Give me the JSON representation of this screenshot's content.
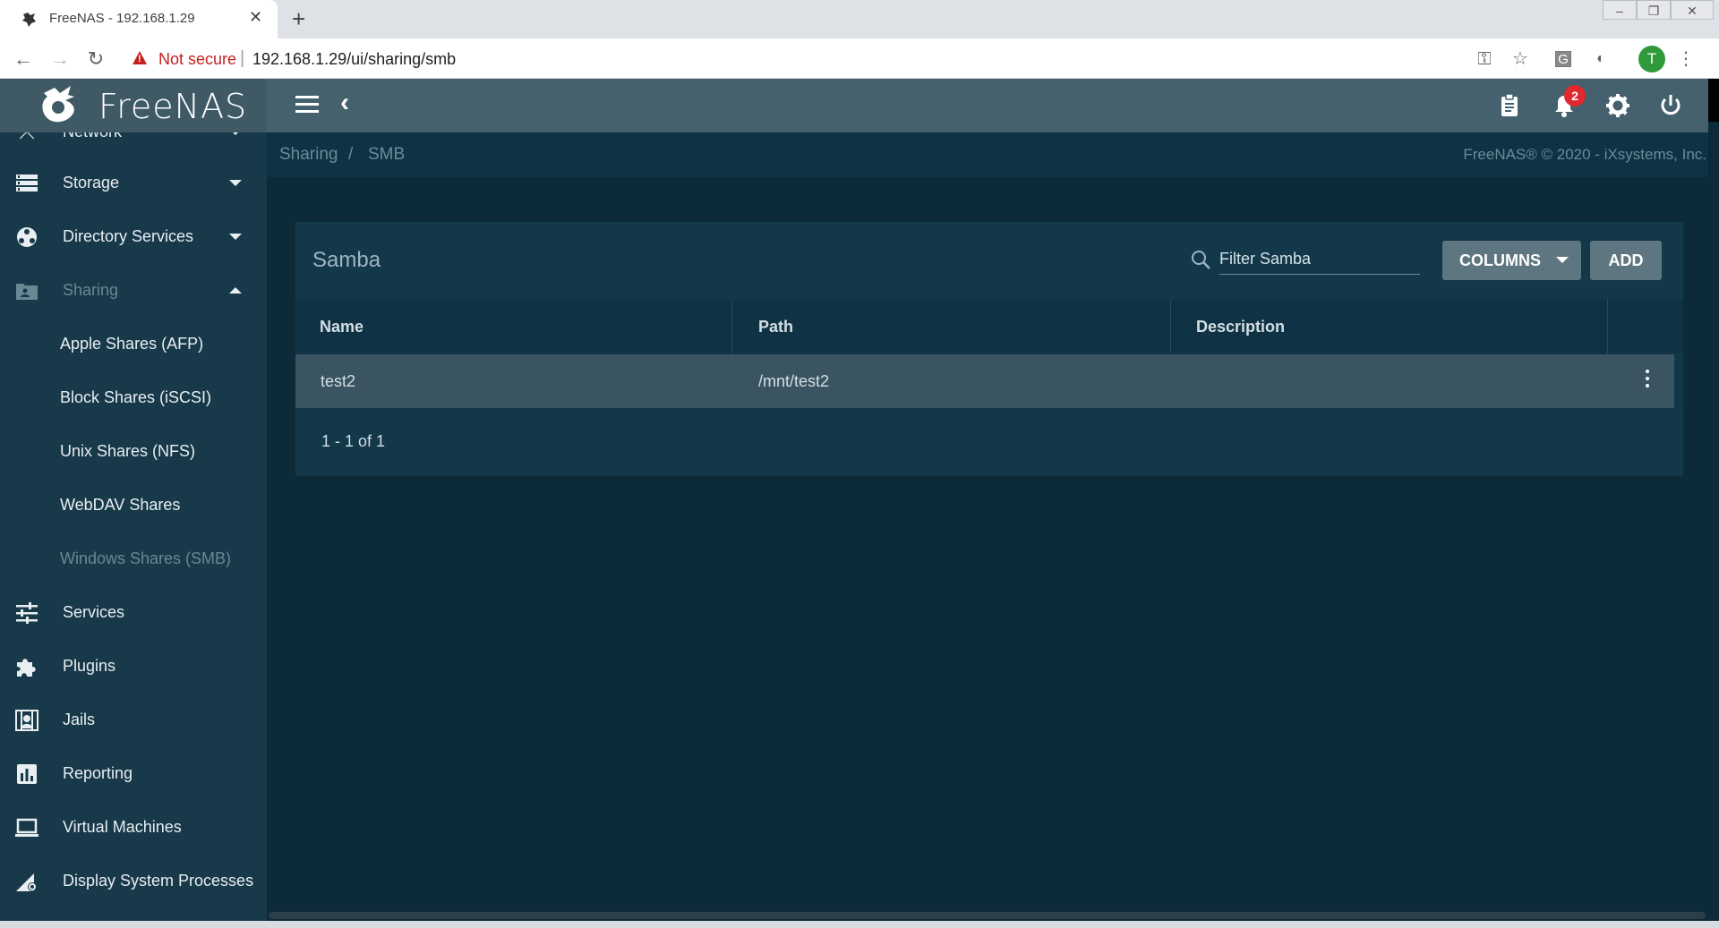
{
  "browser": {
    "tab_title": "FreeNAS - 192.168.1.29",
    "tab_close": "✕",
    "new_tab": "+",
    "security_label": "Not secure",
    "url": "192.168.1.29/ui/sharing/smb",
    "avatar_letter": "T"
  },
  "header": {
    "logo_text": "FreeNAS",
    "notification_count": "2"
  },
  "sidebar": {
    "items": [
      {
        "label": "Network",
        "icon": "network-icon"
      },
      {
        "label": "Storage",
        "icon": "storage-icon"
      },
      {
        "label": "Directory Services",
        "icon": "directory-services-icon"
      },
      {
        "label": "Sharing",
        "icon": "sharing-icon"
      },
      {
        "label": "Services",
        "icon": "services-icon"
      },
      {
        "label": "Plugins",
        "icon": "plugins-icon"
      },
      {
        "label": "Jails",
        "icon": "jails-icon"
      },
      {
        "label": "Reporting",
        "icon": "reporting-icon"
      },
      {
        "label": "Virtual Machines",
        "icon": "virtual-machines-icon"
      },
      {
        "label": "Display System Processes",
        "icon": "system-processes-icon"
      }
    ],
    "sharing_sub": [
      "Apple Shares (AFP)",
      "Block Shares (iSCSI)",
      "Unix Shares (NFS)",
      "WebDAV Shares",
      "Windows Shares (SMB)"
    ]
  },
  "breadcrumb": {
    "parent": "Sharing",
    "separator": "/",
    "current": "SMB",
    "copyright": "FreeNAS® © 2020 - iXsystems, Inc."
  },
  "card": {
    "title": "Samba",
    "filter_placeholder": "Filter Samba",
    "columns_label": "COLUMNS",
    "add_label": "ADD",
    "headers": [
      "Name",
      "Path",
      "Description"
    ],
    "rows": [
      {
        "name": "test2",
        "path": "/mnt/test2",
        "description": ""
      }
    ],
    "pager": "1 - 1 of 1"
  }
}
